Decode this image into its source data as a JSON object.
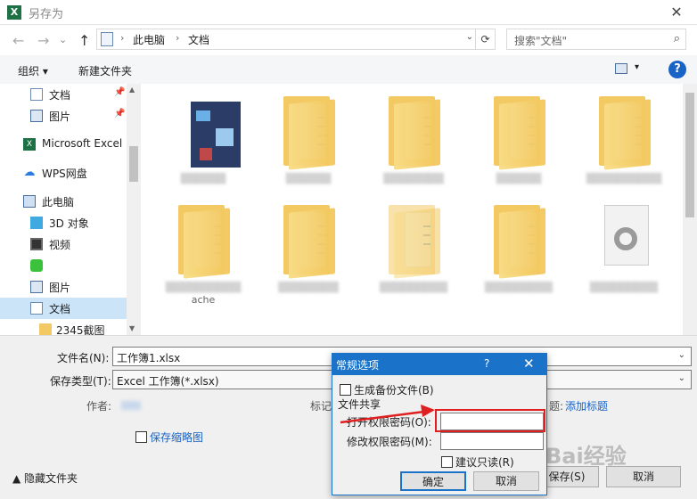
{
  "window": {
    "title": "另存为",
    "close_glyph": "✕"
  },
  "nav": {
    "back": "←",
    "forward": "→",
    "up": "↑"
  },
  "address": {
    "segments": [
      "此电脑",
      "文档"
    ],
    "separator": "›",
    "refresh": "⟳",
    "dropdown": "⌄"
  },
  "search": {
    "placeholder": "搜索\"文档\"",
    "icon": "search-icon"
  },
  "toolbar": {
    "organize": "组织 ▾",
    "new_folder": "新建文件夹",
    "view_dropdown": "▾",
    "help": "?"
  },
  "sidebar": {
    "items": [
      {
        "label": "文档",
        "icon": "document-icon",
        "pinned": true
      },
      {
        "label": "图片",
        "icon": "picture-icon",
        "pinned": true
      },
      {
        "label": "Microsoft Excel",
        "icon": "excel-icon"
      },
      {
        "label": "WPS网盘",
        "icon": "cloud-icon"
      },
      {
        "label": "此电脑",
        "icon": "computer-icon"
      },
      {
        "label": "3D 对象",
        "icon": "cube-icon"
      },
      {
        "label": "视频",
        "icon": "video-icon"
      },
      {
        "label": "",
        "icon": "app-icon"
      },
      {
        "label": "图片",
        "icon": "picture-icon"
      },
      {
        "label": "文档",
        "icon": "document-icon",
        "selected": true
      },
      {
        "label": "2345截图",
        "icon": "folder-icon"
      }
    ]
  },
  "grid": {
    "items": [
      {
        "kind": "photo",
        "name": "▒▒▒▒▒▒"
      },
      {
        "kind": "folder",
        "name": "▒▒▒▒▒▒"
      },
      {
        "kind": "folder",
        "name": "▒▒▒▒▒▒▒▒"
      },
      {
        "kind": "folder",
        "name": "▒▒▒▒▒▒"
      },
      {
        "kind": "folder",
        "name": "▒▒▒▒▒▒▒▒▒▒"
      },
      {
        "kind": "folder",
        "name": "▒▒▒▒▒▒▒▒▒▒",
        "name2": "ache"
      },
      {
        "kind": "folder",
        "name": "▒▒▒▒▒▒▒▒"
      },
      {
        "kind": "folder-faded",
        "name": "▒▒▒▒▒▒▒▒▒"
      },
      {
        "kind": "folder",
        "name": "▒▒▒▒▒▒▒▒▒"
      },
      {
        "kind": "file",
        "name": "▒▒▒▒▒▒▒▒▒"
      }
    ]
  },
  "form": {
    "filename_label": "文件名(N):",
    "filename_value": "工作簿1.xlsx",
    "filetype_label": "保存类型(T):",
    "filetype_value": "Excel 工作簿(*.xlsx)",
    "author_label": "作者:",
    "tags_label": "标记:",
    "tags_link": "添加标题",
    "tags_label_tail": "题:",
    "thumbnail_label": "保存缩略图",
    "hide_folders": "▲ 隐藏文件夹",
    "save_button": "保存(S)",
    "cancel_button": "取消"
  },
  "dialog": {
    "title": "常规选项",
    "help": "?",
    "close": "✕",
    "backup_label": "生成备份文件(B)",
    "sharing_label": "文件共享",
    "open_password_label": "打开权限密码(O):",
    "modify_password_label": "修改权限密码(M):",
    "readonly_label": "建议只读(R)",
    "ok_button": "确定",
    "cancel_button": "取消"
  },
  "watermark": {
    "text": "Bai经验"
  },
  "colors": {
    "accent": "#1a73c8",
    "highlight": "#e02020",
    "selected": "#cce4f7"
  }
}
